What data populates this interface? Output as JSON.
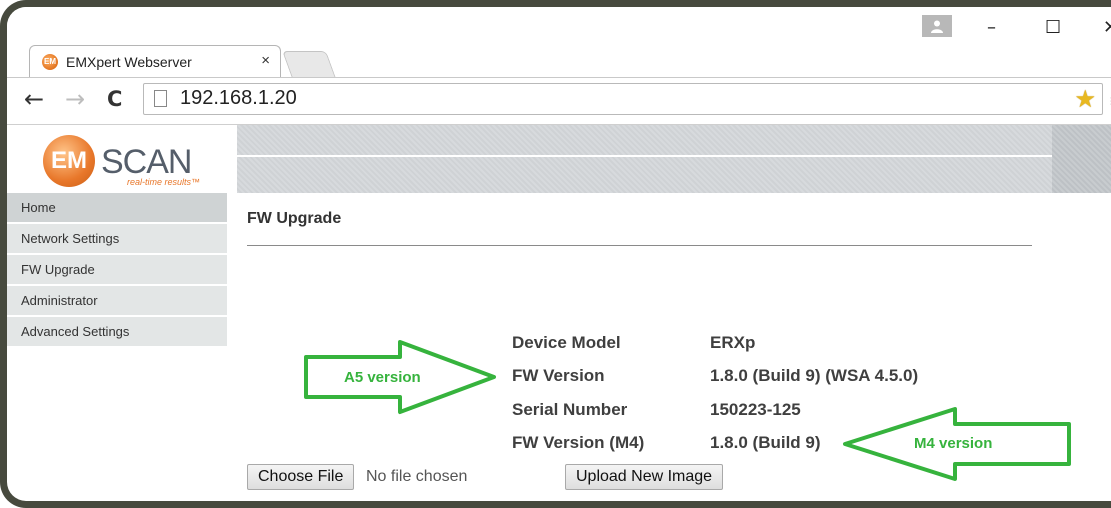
{
  "browser": {
    "tab_title": "EMXpert Webserver",
    "tab_close": "×",
    "url": "192.168.1.20",
    "window_controls": {
      "minimize": "–",
      "maximize": "☐",
      "close": "✕"
    },
    "nav": {
      "back": "←",
      "forward": "→",
      "reload": "C"
    },
    "menu": "≡",
    "favicon_text": "EM",
    "icons": [
      "user-avatar-icon",
      "back-icon",
      "forward-icon",
      "reload-icon",
      "page-icon",
      "bookmark-star-icon",
      "menu-icon"
    ]
  },
  "brand": {
    "logo_initials": "EM",
    "logo_word": "SCAN",
    "tagline": "real-time results™",
    "accent_color": "#e8772a"
  },
  "sidebar": {
    "items": [
      {
        "label": "Home",
        "active": true
      },
      {
        "label": "Network Settings",
        "active": false
      },
      {
        "label": "FW Upgrade",
        "active": false
      },
      {
        "label": "Administrator",
        "active": false
      },
      {
        "label": "Advanced Settings",
        "active": false
      }
    ]
  },
  "main": {
    "title": "FW Upgrade",
    "info": [
      {
        "label": "Device Model",
        "value": "ERXp"
      },
      {
        "label": "FW Version",
        "value": "1.8.0 (Build 9) (WSA 4.5.0)"
      },
      {
        "label": "Serial Number",
        "value": "150223-125"
      },
      {
        "label": "FW Version (M4)",
        "value": "1.8.0 (Build 9)"
      }
    ],
    "choose_file_label": "Choose File",
    "file_status": "No file chosen",
    "upload_label": "Upload New Image"
  },
  "annotations": {
    "a5_label": "A5 version",
    "m4_label": "M4 version",
    "color": "#36b33d"
  }
}
